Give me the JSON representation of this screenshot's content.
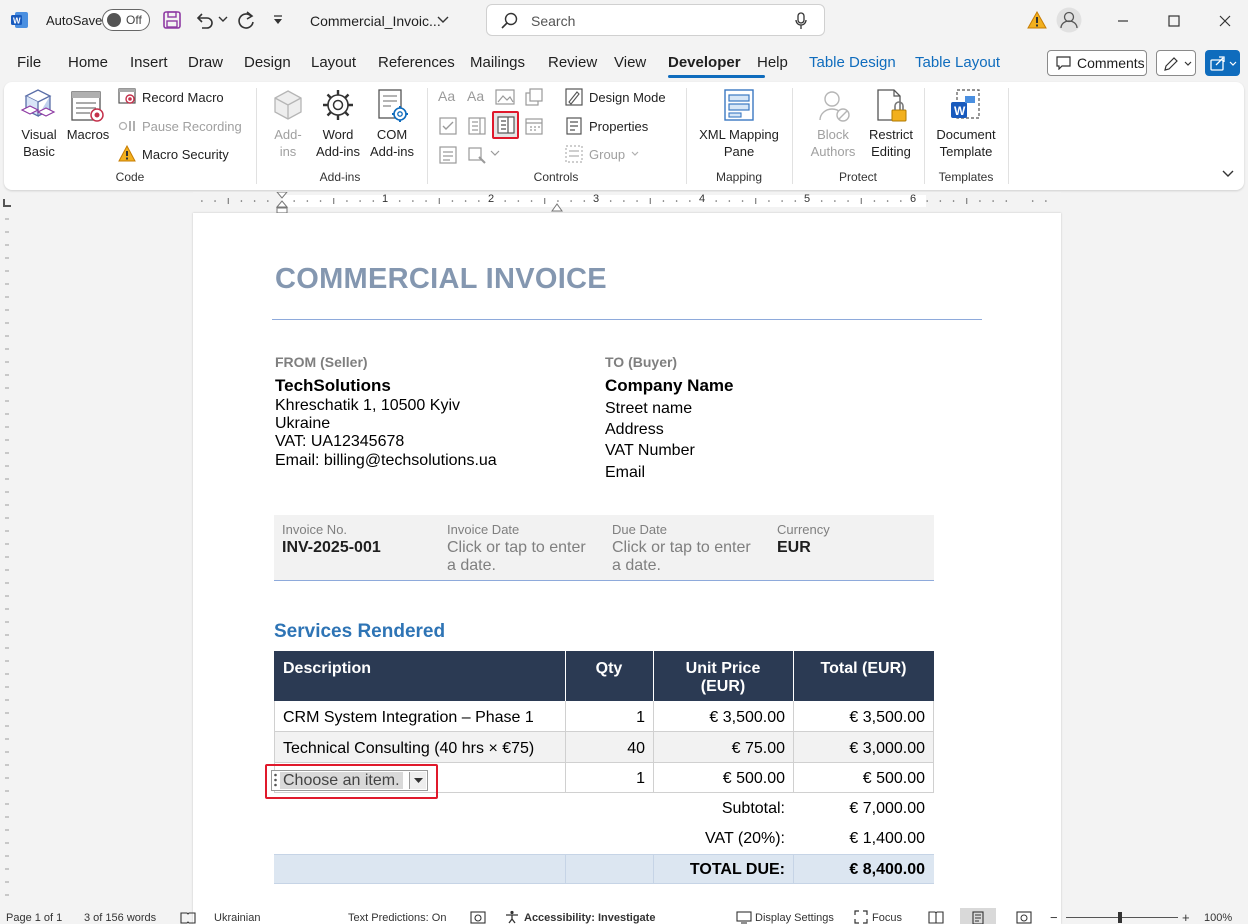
{
  "titlebar": {
    "app_icon": "word-icon",
    "autosave_label": "AutoSave",
    "autosave_state": "Off",
    "doc_title": "Commercial_Invoic...",
    "search_placeholder": "Search"
  },
  "tabs": [
    "File",
    "Home",
    "Insert",
    "Draw",
    "Design",
    "Layout",
    "References",
    "Mailings",
    "Review",
    "View",
    "Developer",
    "Help",
    "Table Design",
    "Table Layout"
  ],
  "active_tab": "Developer",
  "comments_label": "Comments",
  "ribbon": {
    "code": {
      "visual_basic": "Visual Basic",
      "visual_basic_l1": "Visual",
      "visual_basic_l2": "Basic",
      "macros": "Macros",
      "record_macro": "Record Macro",
      "pause_recording": "Pause Recording",
      "macro_security": "Macro Security",
      "group": "Code"
    },
    "addins": {
      "addins_l1": "Add-",
      "addins_l2": "ins",
      "word_l1": "Word",
      "word_l2": "Add-ins",
      "com_l1": "COM",
      "com_l2": "Add-ins",
      "group": "Add-ins"
    },
    "controls": {
      "design_mode": "Design Mode",
      "properties": "Properties",
      "group_btn": "Group",
      "group": "Controls"
    },
    "mapping": {
      "xml_l1": "XML Mapping",
      "xml_l2": "Pane",
      "group": "Mapping"
    },
    "protect": {
      "block_l1": "Block",
      "block_l2": "Authors",
      "restrict_l1": "Restrict",
      "restrict_l2": "Editing",
      "group": "Protect"
    },
    "templates": {
      "doc_l1": "Document",
      "doc_l2": "Template",
      "group": "Templates"
    }
  },
  "ruler": {
    "numbers": [
      "1",
      "2",
      "3",
      "4",
      "5",
      "6"
    ]
  },
  "invoice": {
    "title": "COMMERCIAL INVOICE",
    "from_label": "FROM (Seller)",
    "seller_name": "TechSolutions",
    "seller_address1": "Khreschatik 1, 10500 Kyiv",
    "seller_address2": "Ukraine",
    "seller_vat": "VAT: UA12345678",
    "seller_email": "Email: billing@techsolutions.ua",
    "to_label": "TO (Buyer)",
    "buyer_name": "Company Name",
    "buyer_street": "Street name",
    "buyer_address": "Address",
    "buyer_vat": "VAT Number",
    "buyer_email": "Email",
    "meta": {
      "invoice_no_label": "Invoice No.",
      "invoice_no": "INV-2025-001",
      "invoice_date_label": "Invoice Date",
      "invoice_date_l1": "Click or tap to enter",
      "invoice_date_l2": "a date.",
      "due_date_label": "Due Date",
      "due_date_l1": "Click or tap to enter",
      "due_date_l2": "a date.",
      "currency_label": "Currency",
      "currency": "EUR"
    },
    "services_heading": "Services Rendered",
    "headers": {
      "description": "Description",
      "qty": "Qty",
      "unit_l1": "Unit Price",
      "unit_l2": "(EUR)",
      "total": "Total (EUR)"
    },
    "rows": [
      {
        "desc": "CRM System Integration – Phase 1",
        "qty": "1",
        "unit": "€ 3,500.00",
        "total": "€ 3,500.00"
      },
      {
        "desc": "Technical Consulting (40 hrs × €75)",
        "qty": "40",
        "unit": "€ 75.00",
        "total": "€ 3,000.00"
      },
      {
        "desc": "Choose an item.",
        "qty": "1",
        "unit": "€ 500.00",
        "total": "€ 500.00"
      }
    ],
    "subtotal_label": "Subtotal:",
    "subtotal": "€ 7,000.00",
    "vat_label": "VAT (20%):",
    "vat": "€ 1,400.00",
    "total_label": "TOTAL DUE:",
    "total": "€ 8,400.00"
  },
  "status": {
    "page": "Page 1 of 1",
    "words": "3 of 156 words",
    "language": "Ukrainian",
    "predictions": "Text Predictions: On",
    "accessibility": "Accessibility: Investigate",
    "display_settings": "Display Settings",
    "focus": "Focus",
    "zoom": "100%"
  },
  "colors": {
    "accent": "#0f6cbd",
    "header_dark": "#2b3a53",
    "title_gray": "#8497b0",
    "highlight_red": "#e0192b"
  }
}
